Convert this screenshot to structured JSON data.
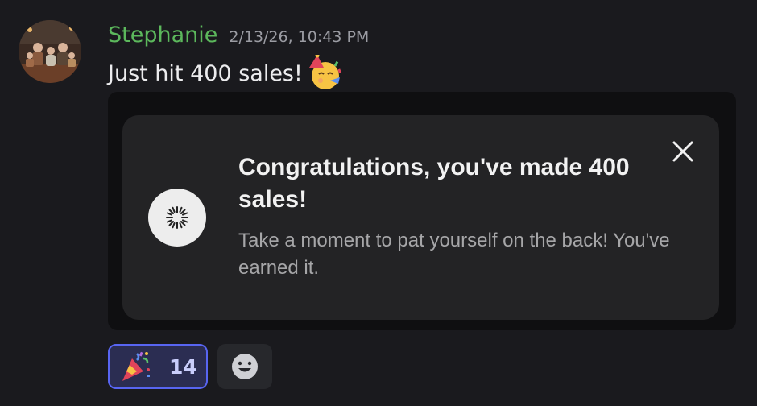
{
  "message": {
    "username": "Stephanie",
    "timestamp": "2/13/26, 10:43 PM",
    "text": "Just hit 400 sales!",
    "inline_emoji": "partying-face-icon"
  },
  "embed": {
    "title": "Congratulations, you've made 400 sales!",
    "body": "Take a moment to pat yourself on the back! You've earned it.",
    "icon": "fireworks-icon",
    "close_icon": "close-icon"
  },
  "reactions": [
    {
      "emoji": "party-popper-icon",
      "count": "14",
      "active": true
    }
  ],
  "add_reaction_icon": "smiley-icon",
  "colors": {
    "background": "#1a1a1e",
    "username": "#5cb85c",
    "reaction_border": "#5865f2",
    "reaction_bg": "#2b2d52"
  }
}
